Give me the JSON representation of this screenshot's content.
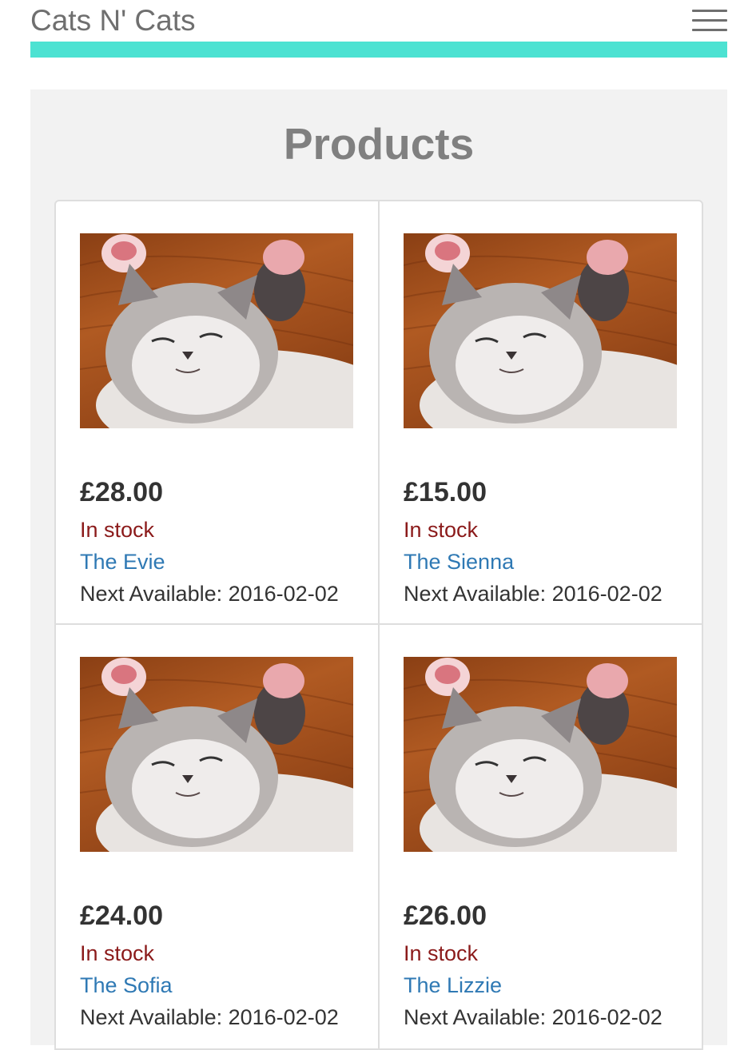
{
  "header": {
    "brand": "Cats N' Cats",
    "menu_icon": "hamburger-menu-icon",
    "accent_color": "#4ce2d2"
  },
  "main": {
    "title": "Products"
  },
  "products": [
    {
      "price": "£28.00",
      "stock": "In stock",
      "name": "The Evie",
      "next_available": "Next Available: 2016-02-02"
    },
    {
      "price": "£15.00",
      "stock": "In stock",
      "name": "The Sienna",
      "next_available": "Next Available: 2016-02-02"
    },
    {
      "price": "£24.00",
      "stock": "In stock",
      "name": "The Sofia",
      "next_available": "Next Available: 2016-02-02"
    },
    {
      "price": "£26.00",
      "stock": "In stock",
      "name": "The Lizzie",
      "next_available": "Next Available: 2016-02-02"
    }
  ],
  "colors": {
    "stock": "#8b1a1a",
    "link": "#2f79b4",
    "title": "#808080"
  }
}
